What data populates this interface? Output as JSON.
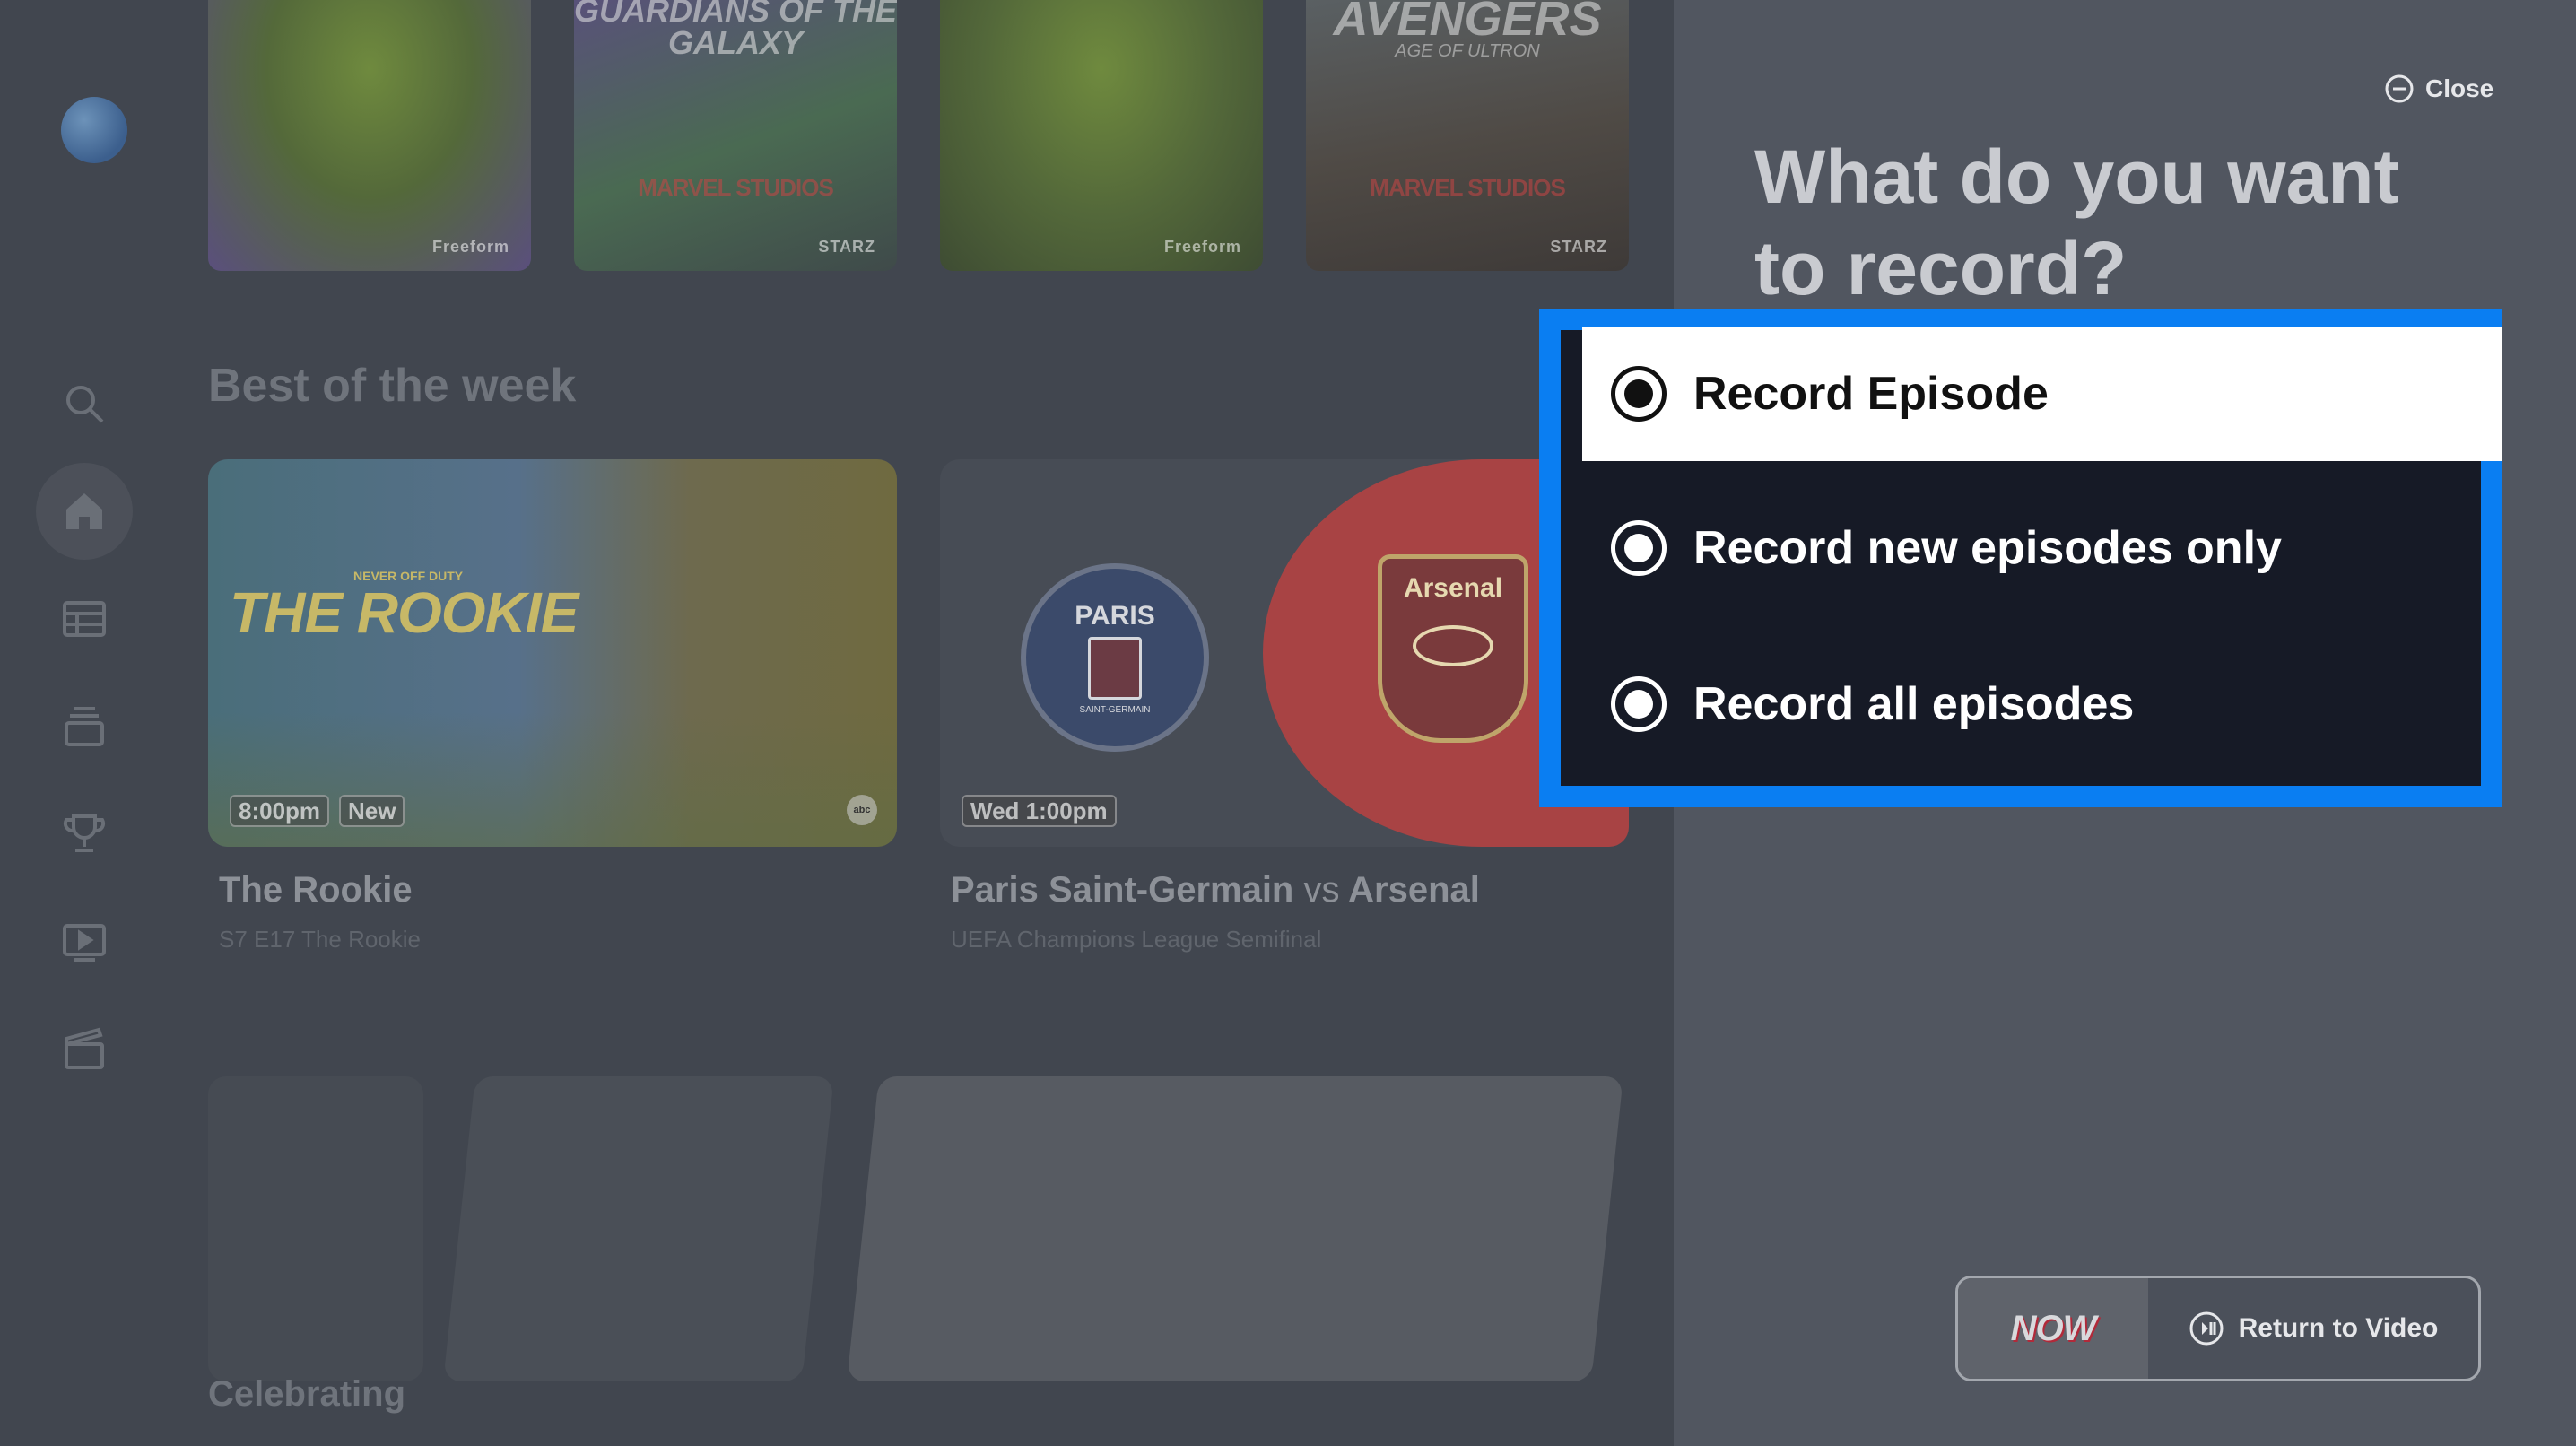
{
  "background_app": {
    "section_title": "Best of the week",
    "top_row_posters": [
      {
        "name": "shrek-poster-1",
        "brand": "Freeform"
      },
      {
        "name": "guardians-poster",
        "title": "GUARDIANS OF THE GALAXY",
        "studio": "MARVEL STUDIOS",
        "brand": "STARZ"
      },
      {
        "name": "shrek-poster-2",
        "brand": "Freeform"
      },
      {
        "name": "avengers-poster",
        "title": "AVENGERS",
        "subtitle": "AGE OF ULTRON",
        "studio": "MARVEL STUDIOS",
        "brand": "STARZ"
      }
    ],
    "cards": [
      {
        "time": "8:00pm",
        "badge": "New",
        "network": "abc",
        "art_text": "THE ROOKIE",
        "art_tagline": "NEVER OFF DUTY",
        "title": "The Rookie",
        "subtitle": "S7 E17 The Rookie"
      },
      {
        "time": "Wed 1:00pm",
        "team1": "Paris Saint-Germain",
        "vs": "vs",
        "team2": "Arsenal",
        "crest1_text": "PARIS",
        "crest1_sub": "SAINT-GERMAIN",
        "crest2_text": "Arsenal",
        "subtitle": "UEFA Champions League Semifinal"
      }
    ],
    "bottom_section_title": "Celebrating"
  },
  "sidebar": {
    "items": [
      {
        "icon": "search-icon"
      },
      {
        "icon": "home-icon",
        "active": true
      },
      {
        "icon": "guide-icon"
      },
      {
        "icon": "dvr-icon"
      },
      {
        "icon": "trophy-icon"
      },
      {
        "icon": "play-icon"
      },
      {
        "icon": "clapper-icon"
      }
    ]
  },
  "dialog": {
    "close_label": "Close",
    "prompt": "What do you want to record?",
    "options": [
      {
        "label": "Record Episode",
        "selected": true
      },
      {
        "label": "Record new episodes only",
        "selected": false
      },
      {
        "label": "Record all episodes",
        "selected": false
      }
    ],
    "focus_color": "#0a7ef2"
  },
  "return_to_video": {
    "channel_logo": "NOW",
    "label": "Return to Video"
  }
}
